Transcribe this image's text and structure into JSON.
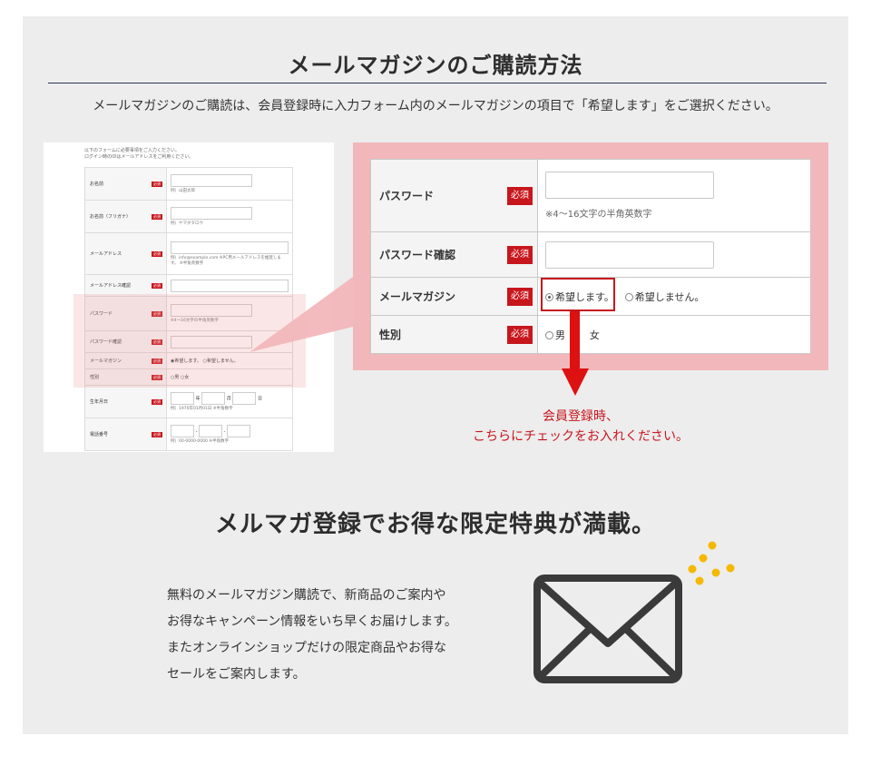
{
  "section_title": "メールマガジンのご購読方法",
  "intro": "メールマガジンのご購読は、会員登録時に入力フォーム内のメールマガジンの項目で「希望します」をご選択ください。",
  "thumbnail": {
    "notes": [
      "以下のフォームに必要事項をご入力ください。",
      "ログイン時のIDはメールアドレスをご利用ください。"
    ],
    "required_badge": "必須",
    "rows": [
      {
        "label": "お名前",
        "example": "例）山田太郎"
      },
      {
        "label": "お名前（フリガナ）",
        "example": "例）ヤマダタロウ"
      },
      {
        "label": "メールアドレス",
        "example": "例）info@example.com ※PC用メールアドレスを推奨します。 ※半角英数字"
      },
      {
        "label": "メールアドレス確認",
        "example": ""
      },
      {
        "label": "パスワード",
        "example": "※4〜16文字の半角英数字"
      },
      {
        "label": "パスワード確認",
        "example": ""
      },
      {
        "label": "メールマガジン",
        "example": "◉希望します。 ○希望しません。"
      },
      {
        "label": "性別",
        "example": "○男 ○女"
      },
      {
        "label": "生年月日",
        "example": "例）1970年01月01日 ※半角数字",
        "fields": [
          "年",
          "月",
          "日"
        ]
      },
      {
        "label": "電話番号",
        "example": "例）00-0000-0000 ※半角数字",
        "fields": [
          "-",
          "-"
        ]
      }
    ]
  },
  "zoom_form": {
    "required_badge": "必須",
    "password": {
      "label": "パスワード",
      "hint": "※4〜16文字の半角英数字"
    },
    "password_confirm": {
      "label": "パスワード確認"
    },
    "newsletter": {
      "label": "メールマガジン",
      "option_yes": "希望します。",
      "option_no": "希望しません。"
    },
    "gender": {
      "label": "性別",
      "option_male": "男",
      "option_female": "女"
    }
  },
  "callout": {
    "line1": "会員登録時、",
    "line2": "こちらにチェックをお入れください。"
  },
  "benefits": {
    "title": "メルマガ登録でお得な限定特典が満載。",
    "lines": [
      "無料のメールマガジン購読で、新商品のご案内や",
      "お得なキャンペーン情報をいち早くお届けします。",
      "またオンラインショップだけの限定商品やお得な",
      "セールをご案内します。"
    ]
  },
  "icons": {
    "envelope": "envelope-icon",
    "sparkle": "sparkle-dots-icon"
  },
  "colors": {
    "accent_red": "#c8161d",
    "highlight_pink": "#f2b7ba",
    "panel_bg": "#ededed",
    "title_rule": "#2a3358",
    "dots": "#f5b800"
  }
}
